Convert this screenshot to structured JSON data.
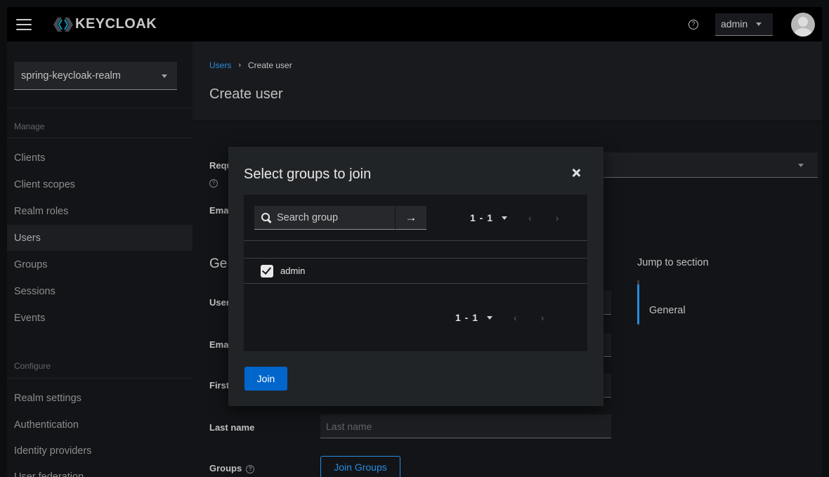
{
  "masthead": {
    "brand": "KEYCLOAK",
    "help_glyph": "?",
    "user": "admin",
    "icons": [
      "menu-icon",
      "keycloak-logo-icon",
      "help-icon",
      "caret-down-icon",
      "avatar-icon"
    ]
  },
  "sidebar": {
    "realm": "spring-keycloak-realm",
    "sections": {
      "manage": "Manage",
      "configure": "Configure"
    },
    "manage_items": [
      {
        "label": "Clients"
      },
      {
        "label": "Client scopes"
      },
      {
        "label": "Realm roles"
      },
      {
        "label": "Users",
        "active": true
      },
      {
        "label": "Groups"
      },
      {
        "label": "Sessions"
      },
      {
        "label": "Events"
      }
    ],
    "configure_items": [
      {
        "label": "Realm settings"
      },
      {
        "label": "Authentication"
      },
      {
        "label": "Identity providers"
      },
      {
        "label": "User federation"
      }
    ]
  },
  "main": {
    "breadcrumb": {
      "parent": "Users",
      "separator": "›",
      "current": "Create user"
    },
    "title": "Create user",
    "background_labels": {
      "required_partial": "Requ",
      "email_verified_partial": "Ema",
      "section_partial": "Ge",
      "username_partial": "User",
      "email_partial": "Ema",
      "first_partial": "First",
      "last_name": "Last name",
      "groups": "Groups"
    },
    "last_name_placeholder": "Last name",
    "join_groups_button": "Join Groups",
    "jump_to_section": "Jump to section",
    "jump_link": "General"
  },
  "modal": {
    "title": "Select groups to join",
    "search_placeholder": "Search group",
    "search_go_glyph": "→",
    "pager_top": {
      "count": "1 - 1",
      "prev": "‹",
      "next": "›"
    },
    "pager_bottom": {
      "count": "1 - 1",
      "prev": "‹",
      "next": "›"
    },
    "rows": [
      {
        "label": "admin",
        "checked": true
      }
    ],
    "join_button": "Join"
  },
  "colors": {
    "accent": "#2b9af3",
    "primary_button": "#0066cc",
    "masthead": "#000000",
    "sidebar": "#151619",
    "modal": "#212427"
  }
}
